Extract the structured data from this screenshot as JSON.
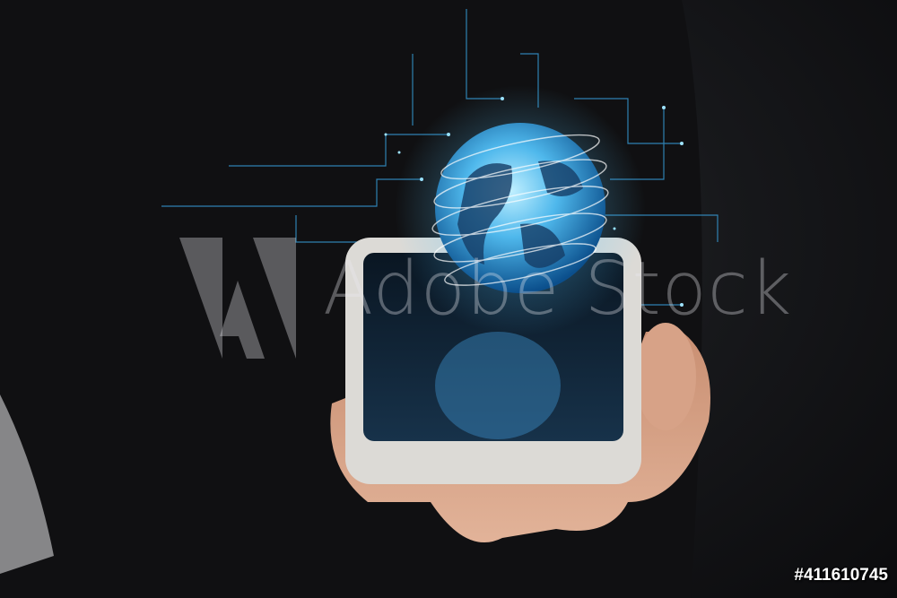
{
  "image": {
    "subject": "hand holding smartphone with holographic globe",
    "colors": {
      "background": "#17181b",
      "glow": "#4fc3ff",
      "phone": "#dcdad6",
      "skin": "#d9a68a"
    }
  },
  "watermark": {
    "brand": "Adobe Stock",
    "logo_icon": "adobe-a-icon"
  },
  "stock_id": "#411610745"
}
